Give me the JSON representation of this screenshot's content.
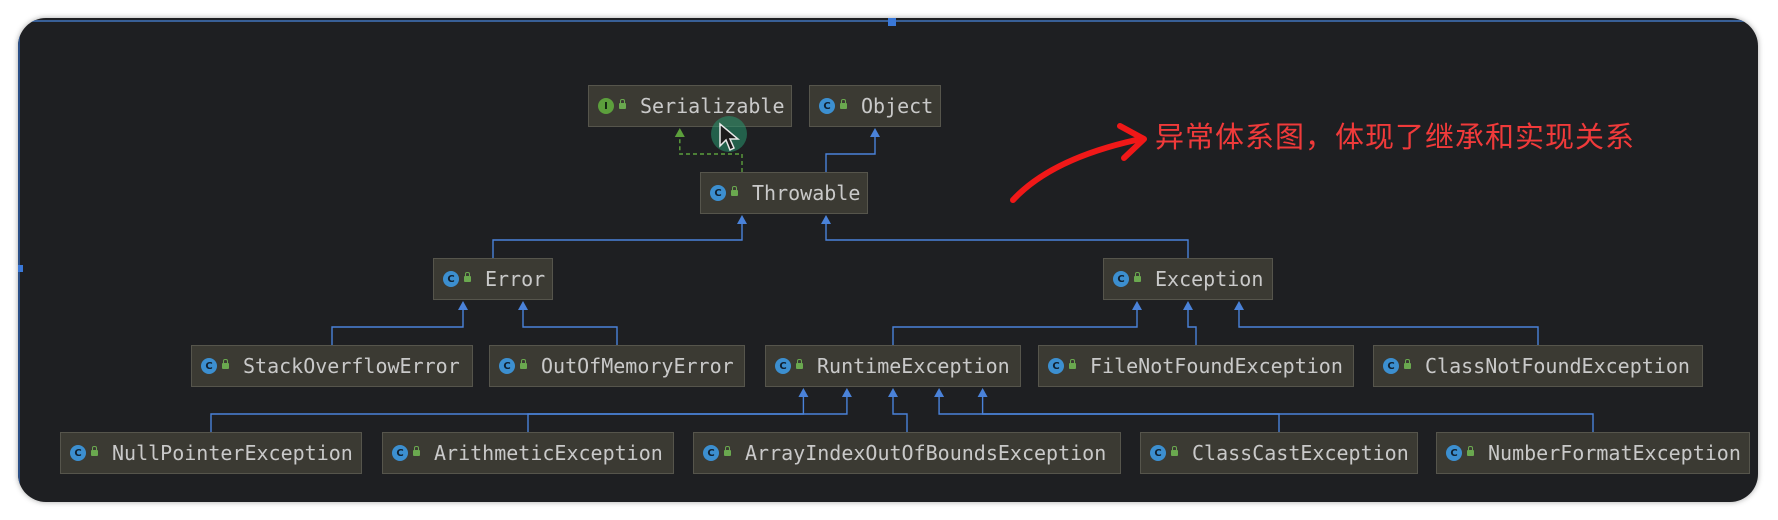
{
  "diagram": {
    "annotation": "异常体系图，体现了继承和实现关系",
    "colors": {
      "background": "#1e1f22",
      "node_fill": "#3b3a33",
      "node_text": "#c9c9c9",
      "extends_edge": "#4a82d9",
      "implements_edge": "#5c9f3c",
      "annotation": "#f03a3a"
    },
    "nodes": [
      {
        "label": "Serializable",
        "kind": "interface",
        "icon": "interface-icon"
      },
      {
        "label": "Object",
        "kind": "class",
        "icon": "class-icon"
      },
      {
        "label": "Throwable",
        "kind": "class",
        "icon": "class-icon"
      },
      {
        "label": "Error",
        "kind": "class",
        "icon": "class-icon"
      },
      {
        "label": "Exception",
        "kind": "class",
        "icon": "class-icon"
      },
      {
        "label": "StackOverflowError",
        "kind": "class",
        "icon": "class-icon"
      },
      {
        "label": "OutOfMemoryError",
        "kind": "class",
        "icon": "class-icon"
      },
      {
        "label": "RuntimeException",
        "kind": "class",
        "icon": "class-icon"
      },
      {
        "label": "FileNotFoundException",
        "kind": "class",
        "icon": "class-icon"
      },
      {
        "label": "ClassNotFoundException",
        "kind": "class",
        "icon": "class-icon"
      },
      {
        "label": "NullPointerException",
        "kind": "class",
        "icon": "class-icon"
      },
      {
        "label": "ArithmeticException",
        "kind": "class",
        "icon": "class-icon"
      },
      {
        "label": "ArrayIndexOutOfBoundsException",
        "kind": "class",
        "icon": "class-icon"
      },
      {
        "label": "ClassCastException",
        "kind": "class",
        "icon": "class-icon"
      },
      {
        "label": "NumberFormatException",
        "kind": "class",
        "icon": "class-icon"
      }
    ],
    "edges": [
      {
        "from": "Throwable",
        "to": "Serializable",
        "type": "implements"
      },
      {
        "from": "Throwable",
        "to": "Object",
        "type": "extends"
      },
      {
        "from": "Error",
        "to": "Throwable",
        "type": "extends"
      },
      {
        "from": "Exception",
        "to": "Throwable",
        "type": "extends"
      },
      {
        "from": "StackOverflowError",
        "to": "Error",
        "type": "extends"
      },
      {
        "from": "OutOfMemoryError",
        "to": "Error",
        "type": "extends"
      },
      {
        "from": "RuntimeException",
        "to": "Exception",
        "type": "extends"
      },
      {
        "from": "FileNotFoundException",
        "to": "Exception",
        "type": "extends"
      },
      {
        "from": "ClassNotFoundException",
        "to": "Exception",
        "type": "extends"
      },
      {
        "from": "NullPointerException",
        "to": "RuntimeException",
        "type": "extends"
      },
      {
        "from": "ArithmeticException",
        "to": "RuntimeException",
        "type": "extends"
      },
      {
        "from": "ArrayIndexOutOfBoundsException",
        "to": "RuntimeException",
        "type": "extends"
      },
      {
        "from": "ClassCastException",
        "to": "RuntimeException",
        "type": "extends"
      },
      {
        "from": "NumberFormatException",
        "to": "RuntimeException",
        "type": "extends"
      }
    ]
  }
}
